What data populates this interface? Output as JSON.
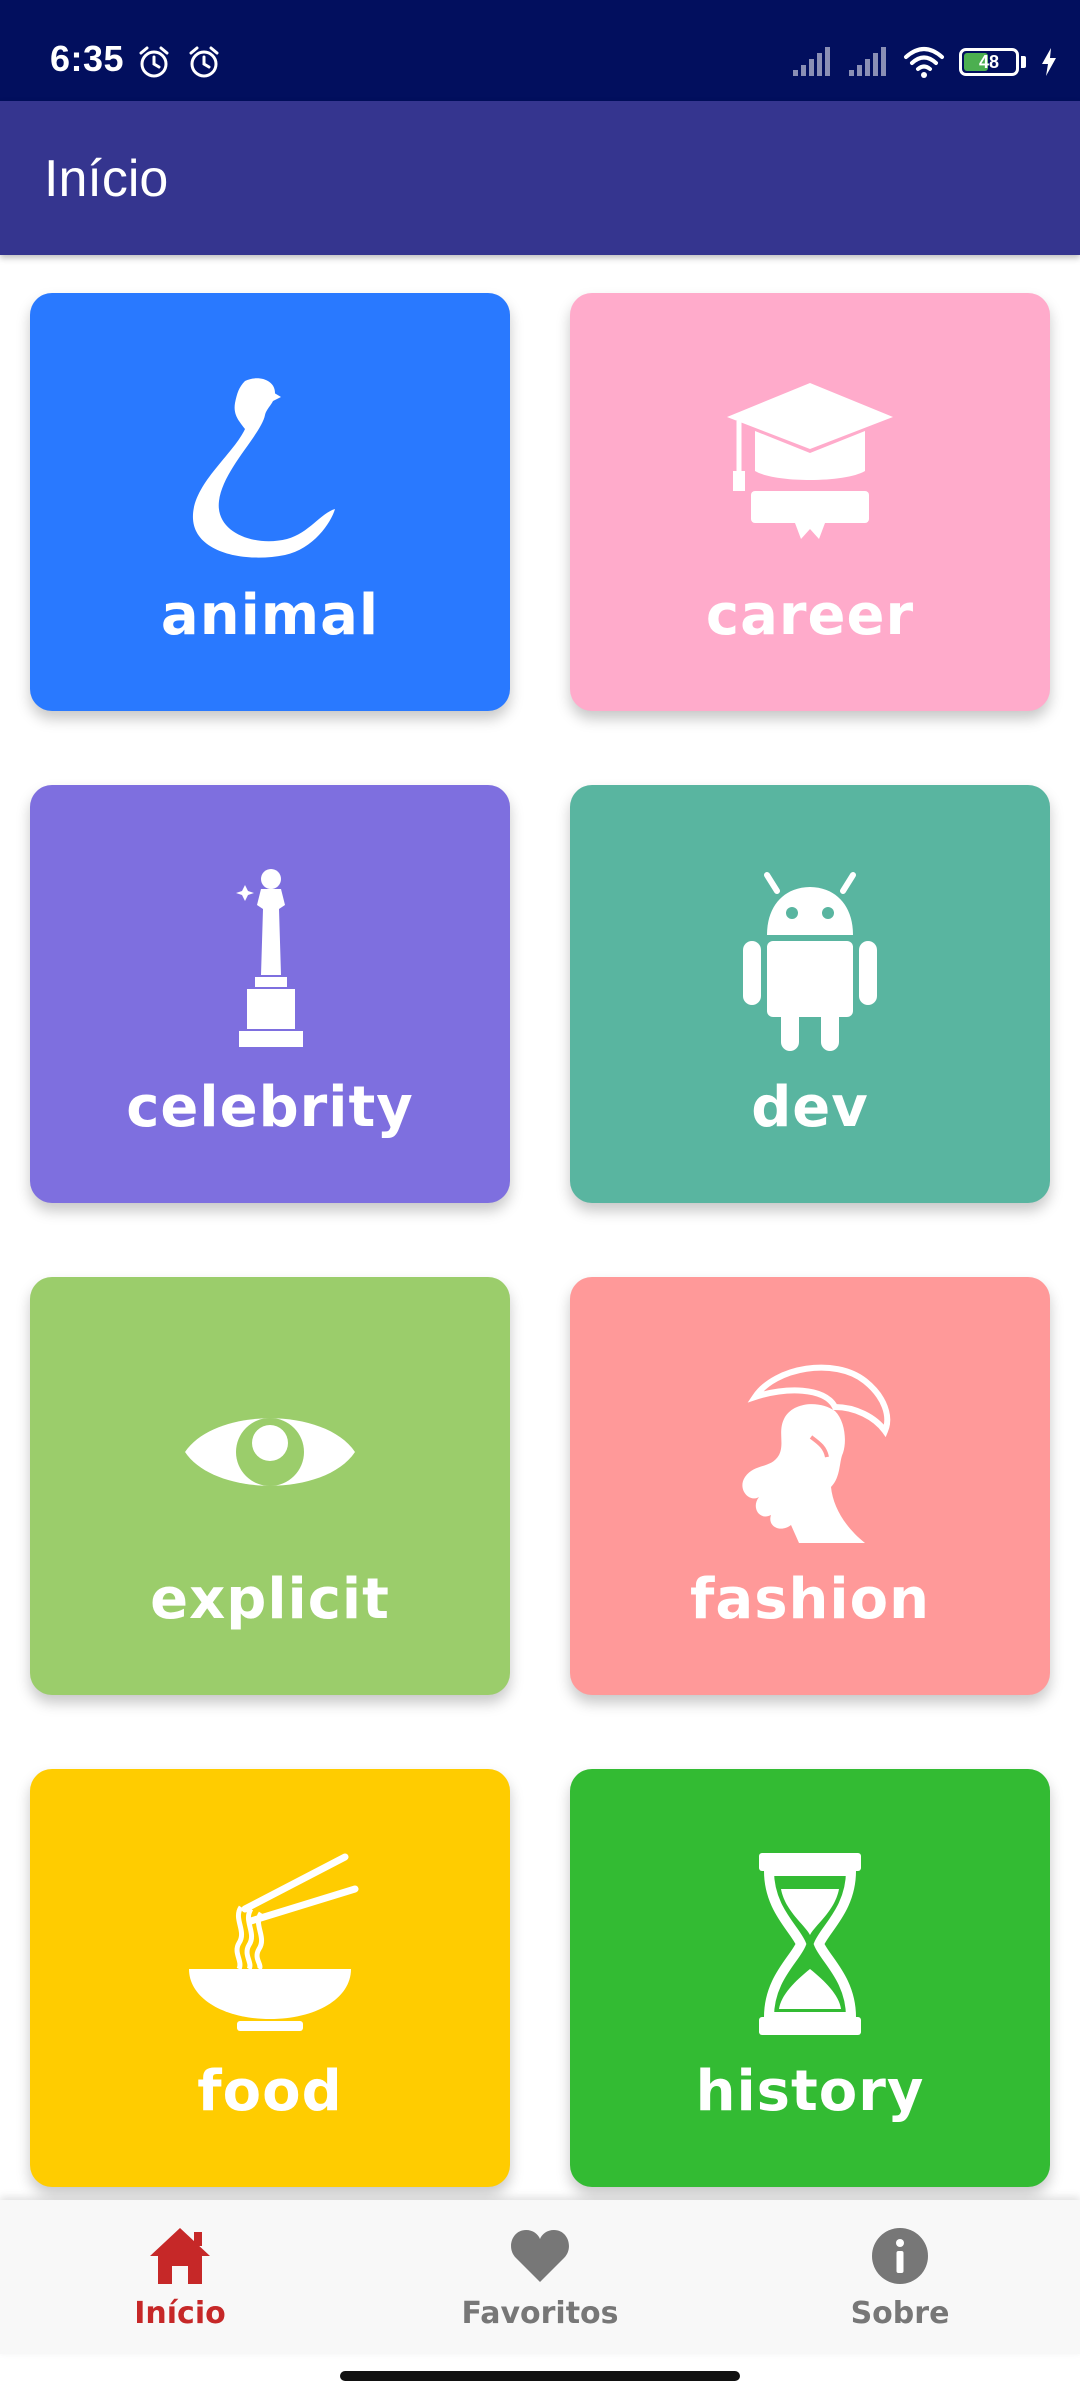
{
  "status_bar": {
    "time": "6:35",
    "battery": "48",
    "battery_level": 0.48,
    "background": "#020f5e"
  },
  "app_bar": {
    "title": "Início",
    "background": "#35358f"
  },
  "categories": [
    {
      "label": "animal",
      "icon": "snake-icon",
      "color": "#2979ff"
    },
    {
      "label": "career",
      "icon": "graduation-cap-icon",
      "color": "#ffabcb"
    },
    {
      "label": "celebrity",
      "icon": "oscar-statue-icon",
      "color": "#7e6fdf"
    },
    {
      "label": "dev",
      "icon": "android-icon",
      "color": "#59b5a0"
    },
    {
      "label": "explicit",
      "icon": "eye-icon",
      "color": "#9bcd6b"
    },
    {
      "label": "fashion",
      "icon": "woman-hat-icon",
      "color": "#ff9999"
    },
    {
      "label": "food",
      "icon": "noodle-bowl-icon",
      "color": "#ffcc00"
    },
    {
      "label": "history",
      "icon": "hourglass-icon",
      "color": "#33bb33"
    }
  ],
  "bottom_nav": {
    "items": [
      {
        "label": "Início",
        "icon": "home-icon",
        "active": true
      },
      {
        "label": "Favoritos",
        "icon": "heart-icon",
        "active": false
      },
      {
        "label": "Sobre",
        "icon": "info-icon",
        "active": false
      }
    ],
    "active_color": "#c62828",
    "inactive_color": "#777777"
  }
}
